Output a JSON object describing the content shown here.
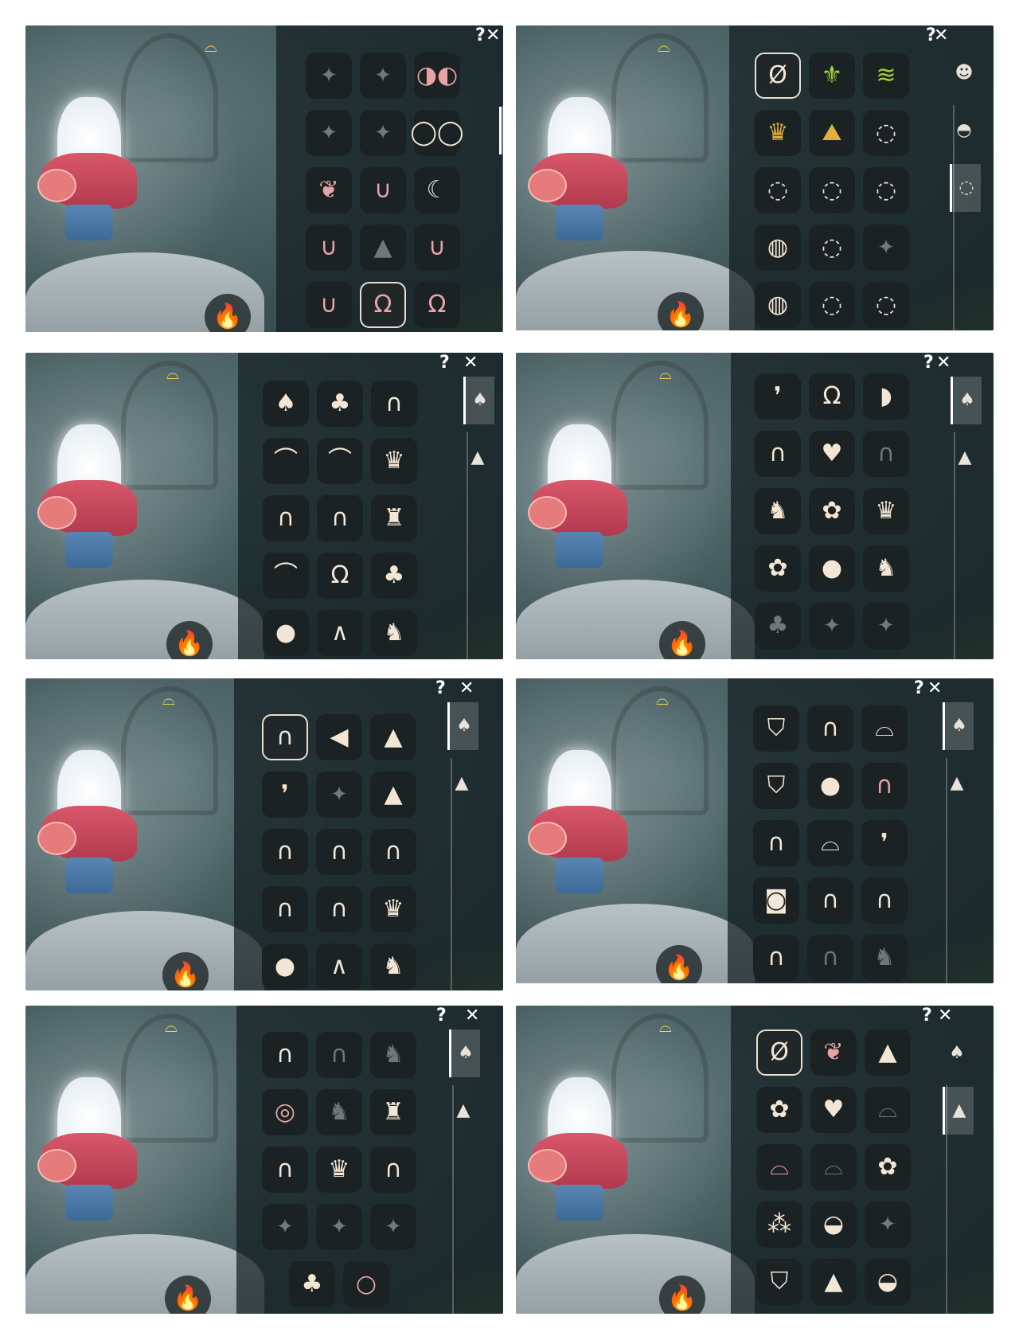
{
  "controls": {
    "help": "?",
    "close": "✕"
  },
  "ui_glyphs": {
    "flame": "🔥",
    "winged_light": "⌓",
    "sparkle": "✦",
    "none": "Ø"
  },
  "panels": [
    {
      "id": "p1",
      "tabs": [
        {
          "icon": "face-icon",
          "glyph": "☻",
          "active": false
        },
        {
          "icon": "mask-icon",
          "glyph": "◓",
          "active": true
        },
        {
          "icon": "necklace-icon",
          "glyph": "◌",
          "active": false
        }
      ],
      "slots": [
        {
          "g": "✦",
          "c": "sparkle",
          "n": "empty-slot"
        },
        {
          "g": "✦",
          "c": "sparkle",
          "n": "empty-slot"
        },
        {
          "g": "◑◐",
          "c": "pink",
          "n": "pink-glasses-icon"
        },
        {
          "g": "✦",
          "c": "sparkle",
          "n": "empty-slot"
        },
        {
          "g": "✦",
          "c": "sparkle",
          "n": "empty-slot"
        },
        {
          "g": "◯◯",
          "c": "",
          "n": "glasses-icon"
        },
        {
          "g": "❦",
          "c": "pink",
          "n": "horns-icon"
        },
        {
          "g": "∪",
          "c": "pink",
          "n": "earring-icon"
        },
        {
          "g": "☾",
          "c": "",
          "n": "star-crown-icon"
        },
        {
          "g": "∪",
          "c": "pink",
          "n": "hook-accessory-icon"
        },
        {
          "g": "▲",
          "c": "dim",
          "n": "mustache-icon"
        },
        {
          "g": "∪",
          "c": "pink",
          "n": "pendant-icon"
        },
        {
          "g": "∪",
          "c": "pink",
          "n": "charm-icon"
        },
        {
          "g": "Ω",
          "c": "pink",
          "n": "headphones-icon",
          "selected": true
        },
        {
          "g": "Ω",
          "c": "pink",
          "n": "headphones-alt-icon"
        }
      ]
    },
    {
      "id": "p2",
      "tabs": [
        {
          "icon": "face-icon",
          "glyph": "☻",
          "active": false
        },
        {
          "icon": "mask-icon",
          "glyph": "◓",
          "active": false
        },
        {
          "icon": "necklace-icon",
          "glyph": "◌",
          "active": true
        }
      ],
      "slots": [
        {
          "g": "Ø",
          "c": "",
          "n": "none-option-icon",
          "selected": true
        },
        {
          "g": "⚜",
          "c": "green",
          "n": "fleur-icon"
        },
        {
          "g": "≋",
          "c": "green",
          "n": "scarf-icon"
        },
        {
          "g": "♛",
          "c": "gold",
          "n": "gold-collar-icon"
        },
        {
          "g": "⛰",
          "c": "gold",
          "n": "mountain-icon"
        },
        {
          "g": "◌",
          "c": "",
          "n": "bead-necklace-icon"
        },
        {
          "g": "◌",
          "c": "",
          "n": "pendant-necklace-icon"
        },
        {
          "g": "◌",
          "c": "",
          "n": "bib-necklace-icon"
        },
        {
          "g": "◌",
          "c": "",
          "n": "charm-necklace-icon"
        },
        {
          "g": "◍",
          "c": "",
          "n": "wrap-scarf-icon"
        },
        {
          "g": "◌",
          "c": "",
          "n": "shell-necklace-icon"
        },
        {
          "g": "✦",
          "c": "sparkle",
          "n": "empty-slot"
        },
        {
          "g": "◍",
          "c": "",
          "n": "knit-scarf-icon"
        },
        {
          "g": "◌",
          "c": "",
          "n": "bow-necklace-icon"
        },
        {
          "g": "◌",
          "c": "",
          "n": "bell-necklace-icon"
        }
      ]
    },
    {
      "id": "p3",
      "tabs": [
        {
          "icon": "hair-icon",
          "glyph": "♠",
          "active": true
        },
        {
          "icon": "hat-icon",
          "glyph": "▲",
          "active": false
        }
      ],
      "slots": [
        {
          "g": "♠",
          "c": "",
          "n": "hair-icon"
        },
        {
          "g": "♣",
          "c": "",
          "n": "hair-icon"
        },
        {
          "g": "∩",
          "c": "",
          "n": "hair-icon"
        },
        {
          "g": "⌒",
          "c": "",
          "n": "hair-icon"
        },
        {
          "g": "⌒",
          "c": "",
          "n": "hair-icon"
        },
        {
          "g": "♛",
          "c": "",
          "n": "hair-icon"
        },
        {
          "g": "∩",
          "c": "",
          "n": "hair-icon"
        },
        {
          "g": "∩",
          "c": "",
          "n": "hair-icon"
        },
        {
          "g": "♜",
          "c": "",
          "n": "hair-icon"
        },
        {
          "g": "⌒",
          "c": "",
          "n": "hair-icon"
        },
        {
          "g": "Ω",
          "c": "",
          "n": "hair-icon"
        },
        {
          "g": "♣",
          "c": "",
          "n": "hair-icon"
        },
        {
          "g": "●",
          "c": "",
          "n": "hair-icon"
        },
        {
          "g": "∧",
          "c": "",
          "n": "hair-icon"
        },
        {
          "g": "♞",
          "c": "",
          "n": "hair-icon"
        }
      ]
    },
    {
      "id": "p4",
      "tabs": [
        {
          "icon": "hair-icon",
          "glyph": "♠",
          "active": true
        },
        {
          "icon": "hat-icon",
          "glyph": "▲",
          "active": false
        }
      ],
      "slots": [
        {
          "g": "❜",
          "c": "",
          "n": "hair-icon"
        },
        {
          "g": "Ω",
          "c": "",
          "n": "hair-icon"
        },
        {
          "g": "◗",
          "c": "",
          "n": "hair-icon"
        },
        {
          "g": "∩",
          "c": "",
          "n": "hair-icon"
        },
        {
          "g": "♥",
          "c": "",
          "n": "hair-icon"
        },
        {
          "g": "∩",
          "c": "dim",
          "n": "hair-icon"
        },
        {
          "g": "♞",
          "c": "",
          "n": "hair-icon"
        },
        {
          "g": "✿",
          "c": "",
          "n": "hair-icon"
        },
        {
          "g": "♛",
          "c": "",
          "n": "hair-icon"
        },
        {
          "g": "✿",
          "c": "",
          "n": "hair-icon"
        },
        {
          "g": "●",
          "c": "",
          "n": "hair-icon"
        },
        {
          "g": "♞",
          "c": "",
          "n": "hair-icon"
        },
        {
          "g": "♣",
          "c": "dim",
          "n": "hair-icon"
        },
        {
          "g": "✦",
          "c": "sparkle",
          "n": "empty-slot"
        },
        {
          "g": "✦",
          "c": "sparkle",
          "n": "empty-slot"
        }
      ]
    },
    {
      "id": "p5",
      "tabs": [
        {
          "icon": "hair-icon",
          "glyph": "♠",
          "active": true
        },
        {
          "icon": "hat-icon",
          "glyph": "▲",
          "active": false
        }
      ],
      "slots": [
        {
          "g": "∩",
          "c": "",
          "n": "hair-icon",
          "selected": true
        },
        {
          "g": "◀",
          "c": "",
          "n": "hair-icon"
        },
        {
          "g": "▲",
          "c": "",
          "n": "hair-icon"
        },
        {
          "g": "❜",
          "c": "",
          "n": "hair-icon"
        },
        {
          "g": "✦",
          "c": "sparkle",
          "n": "empty-slot"
        },
        {
          "g": "▲",
          "c": "",
          "n": "hair-icon"
        },
        {
          "g": "∩",
          "c": "",
          "n": "hair-icon"
        },
        {
          "g": "∩",
          "c": "",
          "n": "hair-icon"
        },
        {
          "g": "∩",
          "c": "",
          "n": "hair-icon"
        },
        {
          "g": "∩",
          "c": "",
          "n": "hair-icon"
        },
        {
          "g": "∩",
          "c": "",
          "n": "hair-icon"
        },
        {
          "g": "♛",
          "c": "",
          "n": "hair-icon"
        },
        {
          "g": "●",
          "c": "",
          "n": "hair-icon"
        },
        {
          "g": "∧",
          "c": "",
          "n": "hair-icon"
        },
        {
          "g": "♞",
          "c": "",
          "n": "hair-icon"
        }
      ]
    },
    {
      "id": "p6",
      "tabs": [
        {
          "icon": "hair-icon",
          "glyph": "♠",
          "active": true
        },
        {
          "icon": "hat-icon",
          "glyph": "▲",
          "active": false
        }
      ],
      "slots": [
        {
          "g": "⛉",
          "c": "",
          "n": "hat-icon"
        },
        {
          "g": "∩",
          "c": "",
          "n": "hair-icon"
        },
        {
          "g": "⌓",
          "c": "",
          "n": "hat-icon"
        },
        {
          "g": "⛉",
          "c": "",
          "n": "hat-icon"
        },
        {
          "g": "●",
          "c": "",
          "n": "hair-icon"
        },
        {
          "g": "∩",
          "c": "pink",
          "n": "hair-icon"
        },
        {
          "g": "∩",
          "c": "",
          "n": "hair-icon"
        },
        {
          "g": "⌓",
          "c": "",
          "n": "hat-icon"
        },
        {
          "g": "❜",
          "c": "",
          "n": "hair-icon"
        },
        {
          "g": "◙",
          "c": "",
          "n": "hair-icon"
        },
        {
          "g": "∩",
          "c": "",
          "n": "hair-icon"
        },
        {
          "g": "∩",
          "c": "",
          "n": "hair-icon"
        },
        {
          "g": "∩",
          "c": "",
          "n": "hair-icon"
        },
        {
          "g": "∩",
          "c": "dim",
          "n": "hair-icon"
        },
        {
          "g": "♞",
          "c": "dim",
          "n": "hair-icon"
        }
      ]
    },
    {
      "id": "p7",
      "tabs": [
        {
          "icon": "hair-icon",
          "glyph": "♠",
          "active": true
        },
        {
          "icon": "hat-icon",
          "glyph": "▲",
          "active": false
        }
      ],
      "slots": [
        {
          "g": "∩",
          "c": "",
          "n": "hair-icon"
        },
        {
          "g": "∩",
          "c": "dim",
          "n": "hair-icon"
        },
        {
          "g": "♞",
          "c": "dim",
          "n": "hair-icon"
        },
        {
          "g": "◎",
          "c": "pink",
          "n": "hair-icon"
        },
        {
          "g": "♞",
          "c": "dim",
          "n": "hair-icon"
        },
        {
          "g": "♜",
          "c": "",
          "n": "lion-mask-icon"
        },
        {
          "g": "∩",
          "c": "",
          "n": "hair-icon"
        },
        {
          "g": "♛",
          "c": "",
          "n": "hair-icon"
        },
        {
          "g": "∩",
          "c": "",
          "n": "hair-icon"
        },
        {
          "g": "✦",
          "c": "sparkle",
          "n": "empty-slot"
        },
        {
          "g": "✦",
          "c": "sparkle",
          "n": "empty-slot"
        },
        {
          "g": "✦",
          "c": "sparkle",
          "n": "empty-slot"
        }
      ],
      "extra_slots": [
        {
          "g": "♣",
          "c": "",
          "n": "hair-icon"
        },
        {
          "g": "○",
          "c": "pink",
          "n": "hair-icon"
        }
      ]
    },
    {
      "id": "p8",
      "tabs": [
        {
          "icon": "hair-icon",
          "glyph": "♠",
          "active": false
        },
        {
          "icon": "hat-icon",
          "glyph": "▲",
          "active": true
        }
      ],
      "slots": [
        {
          "g": "Ø",
          "c": "",
          "n": "none-option-icon",
          "selected": true
        },
        {
          "g": "❦",
          "c": "pink",
          "n": "horns-icon"
        },
        {
          "g": "▲",
          "c": "",
          "n": "hat-icon"
        },
        {
          "g": "✿",
          "c": "",
          "n": "hat-icon"
        },
        {
          "g": "♥",
          "c": "",
          "n": "bow-icon"
        },
        {
          "g": "⌓",
          "c": "dim",
          "n": "hat-icon"
        },
        {
          "g": "⌓",
          "c": "pink",
          "n": "hat-icon"
        },
        {
          "g": "⌓",
          "c": "dim",
          "n": "hat-icon"
        },
        {
          "g": "✿",
          "c": "",
          "n": "flower-icon"
        },
        {
          "g": "⁂",
          "c": "",
          "n": "flower-crown-icon"
        },
        {
          "g": "◒",
          "c": "",
          "n": "shell-icon"
        },
        {
          "g": "✦",
          "c": "sparkle",
          "n": "empty-slot"
        },
        {
          "g": "⛉",
          "c": "",
          "n": "hat-icon"
        },
        {
          "g": "▲",
          "c": "",
          "n": "party-hat-icon"
        },
        {
          "g": "◒",
          "c": "",
          "n": "bandana-icon"
        }
      ]
    }
  ]
}
